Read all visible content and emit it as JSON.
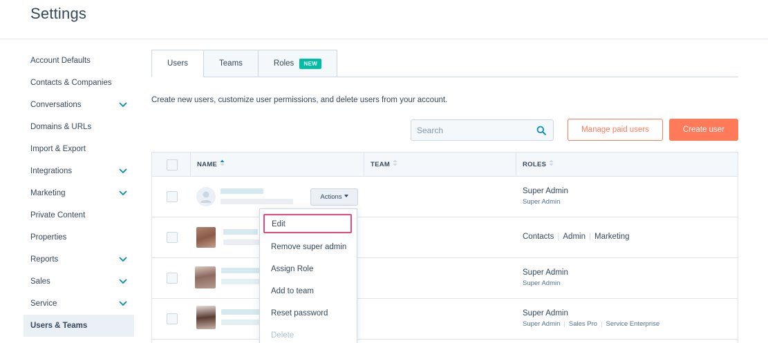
{
  "header": {
    "title": "Settings"
  },
  "sidebar": {
    "items": [
      {
        "label": "Account Defaults",
        "expandable": false
      },
      {
        "label": "Contacts & Companies",
        "expandable": false
      },
      {
        "label": "Conversations",
        "expandable": true
      },
      {
        "label": "Domains & URLs",
        "expandable": false
      },
      {
        "label": "Import & Export",
        "expandable": false
      },
      {
        "label": "Integrations",
        "expandable": true
      },
      {
        "label": "Marketing",
        "expandable": true
      },
      {
        "label": "Private Content",
        "expandable": false
      },
      {
        "label": "Properties",
        "expandable": false
      },
      {
        "label": "Reports",
        "expandable": true
      },
      {
        "label": "Sales",
        "expandable": true
      },
      {
        "label": "Service",
        "expandable": true
      },
      {
        "label": "Users & Teams",
        "expandable": false,
        "active": true
      }
    ]
  },
  "tabs": [
    {
      "label": "Users",
      "active": true
    },
    {
      "label": "Teams",
      "active": false
    },
    {
      "label": "Roles",
      "active": false,
      "badge": "NEW"
    }
  ],
  "description": "Create new users, customize user permissions, and delete users from your account.",
  "search": {
    "placeholder": "Search",
    "value": ""
  },
  "buttons": {
    "manage_paid": "Manage paid users",
    "create_user": "Create user"
  },
  "table": {
    "columns": {
      "name": "NAME",
      "team": "TEAM",
      "roles": "ROLES"
    },
    "actions_label": "Actions",
    "rows": [
      {
        "role_main": "Super Admin",
        "role_sub": [
          "Super Admin"
        ]
      },
      {
        "role_main_parts": [
          "Contacts",
          "Admin",
          "Marketing"
        ]
      },
      {
        "role_main": "Super Admin",
        "role_sub": [
          "Super Admin"
        ]
      },
      {
        "role_main": "Super Admin",
        "role_sub": [
          "Super Admin",
          "Sales Pro",
          "Service Enterprise"
        ]
      }
    ]
  },
  "actions_menu": {
    "items": [
      {
        "label": "Edit",
        "highlighted": true
      },
      {
        "label": "Remove super admin"
      },
      {
        "label": "Assign Role"
      },
      {
        "label": "Add to team"
      },
      {
        "label": "Reset password"
      },
      {
        "label": "Delete",
        "disabled": true
      }
    ]
  },
  "colors": {
    "accent": "#ff7a59",
    "badge": "#00bda5",
    "highlight_border": "#e8457f",
    "text": "#33475b"
  },
  "icons": {
    "sort": "sort-arrows-icon",
    "search": "search-icon",
    "expand": "chevron-down-icon",
    "caret": "caret-down-icon"
  }
}
